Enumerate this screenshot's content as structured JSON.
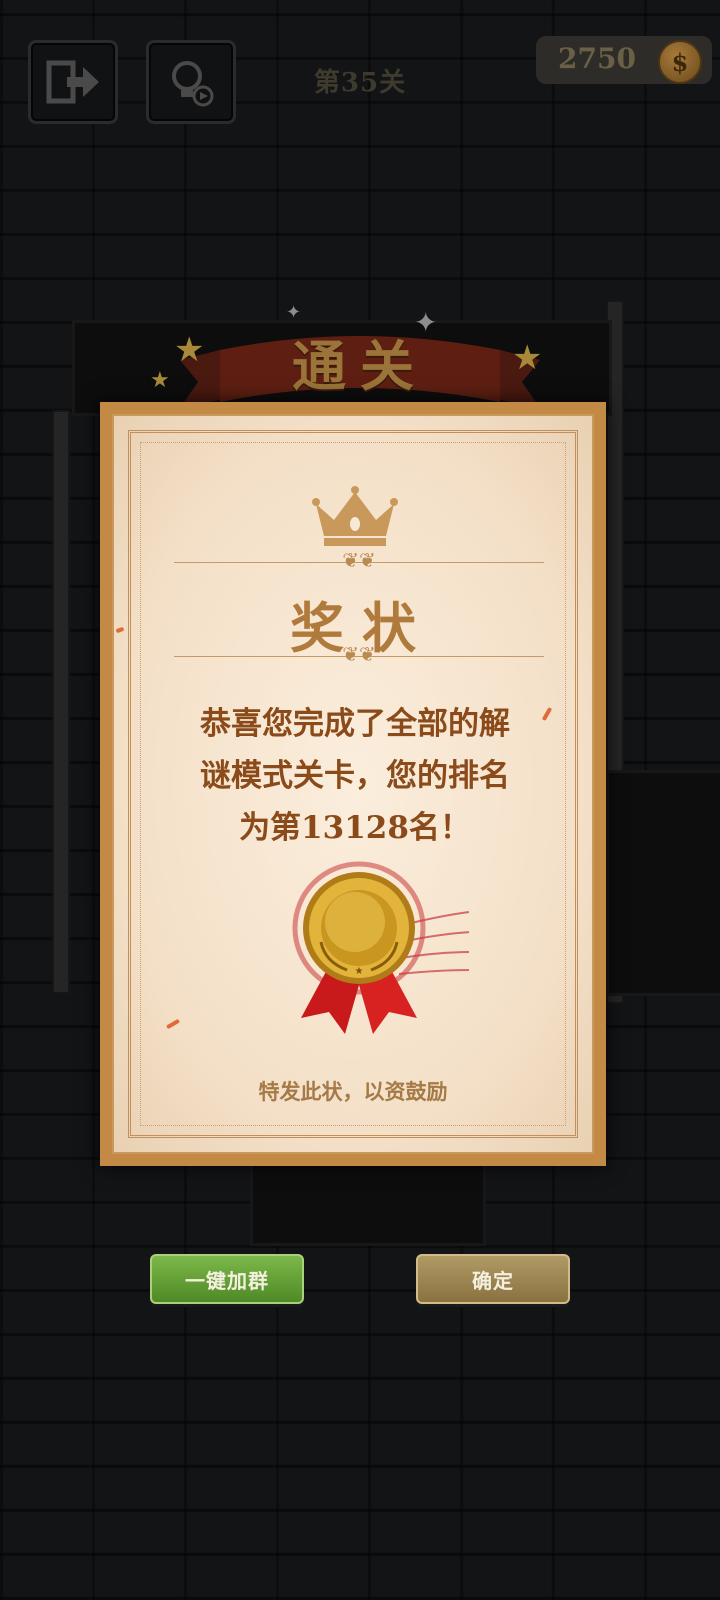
{
  "header": {
    "level_title": "第35关",
    "coins": "2750",
    "coin_symbol": "$"
  },
  "banner": {
    "text": "通关"
  },
  "certificate": {
    "title": "奖状",
    "message_lines": [
      "恭喜您完成了全部的解",
      "谜模式关卡，您的排名",
      "为第13128名！"
    ],
    "footer": "特发此状，以资鼓励"
  },
  "buttons": {
    "join_group": "一键加群",
    "confirm": "确定"
  },
  "icons": {
    "exit": "exit-icon",
    "hint": "lightbulb-video-icon",
    "coin": "coin-icon",
    "crown": "crown-icon",
    "medal": "gold-medal-icon"
  },
  "colors": {
    "join_button": "#5f9e33",
    "confirm_button": "#9e8650",
    "certificate_text": "#8a4a1a",
    "certificate_title": "#b07a3c"
  }
}
